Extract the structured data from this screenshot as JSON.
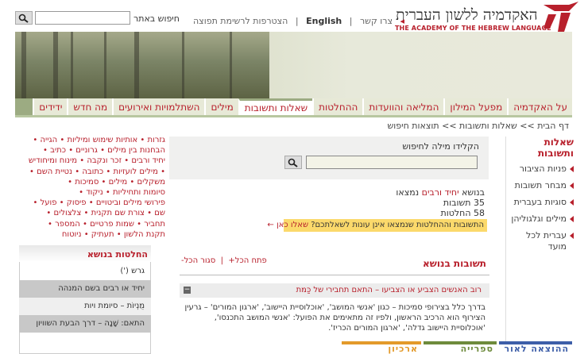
{
  "header": {
    "search_label": "חיפוש באתר",
    "links": [
      "צרו קשר",
      "English",
      "הצטרפות לרשימת תפוצה"
    ],
    "title_he": "האקדמיה ללשון העברית",
    "title_en": "THE ACADEMY OF THE HEBREW LANGUAGE"
  },
  "nav": {
    "items": [
      "על האקדמיה",
      "מפעל המילון",
      "המליאה והוועדות",
      "ההחלטות",
      "שאלות ותשובות",
      "מילים",
      "השתלמויות ואירועים",
      "מה חדש",
      "ידידים"
    ],
    "active_index": 4
  },
  "breadcrumb": "דף הבית >> שאלות ותשובות >> תוצאות חיפוש",
  "right_menu": {
    "title": "שאלות ותשובות",
    "items": [
      "פניות הציבור",
      "מבחר תשובות",
      "סוגיות בעברית",
      "מילים וגלגוליהן",
      "עברית לכל מועד"
    ]
  },
  "search_panel": {
    "label": "הקלידו מילה לחיפוש",
    "value": ""
  },
  "results": {
    "topic_prefix": "בנושא",
    "topic": "יחיד ורבים",
    "topic_suffix": "נמצאו",
    "line2": "35 תשובות",
    "line3": "58 החלטות"
  },
  "notice": {
    "text": "התשובות וההחלטות שנמצאו אינן עונות לשאלתכם?",
    "link": "שאלו כאן"
  },
  "answers": {
    "header": "תשובות בנושא",
    "open_all": "פתח הכל+",
    "close_all": "סגור הכל-",
    "item_title": "רוב האנשים הצביע או הצביעו – התאם תחבירי של כַּמּת",
    "item_toggle": "−",
    "item_body": "בדרך כלל בצירופי סמיכות – כגון 'אנשי המושב', 'אוכלוסיית היישוב', 'ארגון המורים' – גרעין הצירוף הוא הרכיב הראשון, ולפיו זה מתאימים את הפועל: 'אנשי המושב התכנסו', 'אוכלוסיית היישוב גדלה', 'ארגון המורים הכריז'."
  },
  "tags": [
    {
      "label": "גזרות"
    },
    {
      "label": "אותיות שימוש ומיליות"
    },
    {
      "label": "הגייה"
    },
    {
      "label": "הבחנות בין מילים"
    },
    {
      "label": "גרוניים"
    },
    {
      "label": "כתיב"
    },
    {
      "label": "יחיד ורבים"
    },
    {
      "label": "זכר ונקבה"
    },
    {
      "label": "מינוח ומיחודיש"
    },
    {
      "label": "מילים לועזיות"
    },
    {
      "label": "כתובה"
    },
    {
      "label": "נטיית השם"
    },
    {
      "label": "משקלים"
    },
    {
      "label": "מילים"
    },
    {
      "label": "סמיכות"
    },
    {
      "label": "סיומות ותחיליות"
    },
    {
      "label": "ניקוד"
    },
    {
      "label": "פירושי מילים וביטויים"
    },
    {
      "label": "פיסוק"
    },
    {
      "label": "פועל"
    },
    {
      "label": "שם"
    },
    {
      "label": "צורת שם תקנית"
    },
    {
      "label": "צלצולים"
    },
    {
      "label": "תחביר"
    },
    {
      "label": "שמות פרטיים"
    },
    {
      "label": "המספר"
    },
    {
      "label": "תקנת הלשון"
    },
    {
      "label": "תעתיק"
    },
    {
      "label": "ניוטוח"
    }
  ],
  "left_panel": {
    "title": "החלטות בנושא",
    "rows": [
      "גרש (')",
      "יחיד או רבים בשם המנהה",
      "מֻנְיוֹת – סיומת ויות",
      "התאם: שָׁנָה – דרך הבעת השוויון"
    ]
  },
  "footer": {
    "tabs": [
      {
        "label": "ההוצאה לאור",
        "color": "#3d5ea8"
      },
      {
        "label": "ספרייה",
        "color": "#6e8b3c"
      },
      {
        "label": "ארכיון האקדמיה",
        "color": "#e39a2a"
      }
    ]
  },
  "colors": {
    "accent": "#b8202c",
    "nav_bg": "#9cab82",
    "notice_bg": "#fbd96b"
  }
}
